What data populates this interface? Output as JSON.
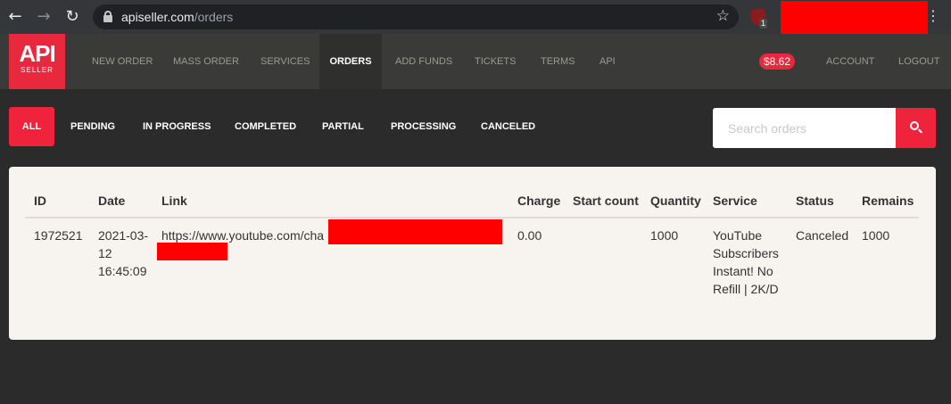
{
  "browser": {
    "back_icon": "arrow-left-icon",
    "forward_icon": "arrow-right-icon",
    "reload_icon": "reload-icon",
    "url_domain": "apiseller.com",
    "url_path": "/orders",
    "extension_badge": "1"
  },
  "site": {
    "logo_main": "API",
    "logo_sub": "SELLER",
    "nav": {
      "new_order": "NEW ORDER",
      "mass_order": "MASS ORDER",
      "services": "SERVICES",
      "orders": "ORDERS",
      "add_funds": "ADD FUNDS",
      "tickets": "TICKETS",
      "terms": "TERMS",
      "api": "API",
      "balance": "$8.62",
      "account": "ACCOUNT",
      "logout": "LOGOUT"
    }
  },
  "filters": {
    "all": "ALL",
    "pending": "PENDING",
    "in_progress": "IN PROGRESS",
    "completed": "COMPLETED",
    "partial": "PARTIAL",
    "processing": "PROCESSING",
    "canceled": "CANCELED"
  },
  "search": {
    "placeholder": "Search orders"
  },
  "table": {
    "headers": {
      "id": "ID",
      "date": "Date",
      "link": "Link",
      "charge": "Charge",
      "start_count": "Start count",
      "quantity": "Quantity",
      "service": "Service",
      "status": "Status",
      "remains": "Remains"
    },
    "rows": [
      {
        "id": "1972521",
        "date_line1": "2021-03-",
        "date_line2": "12",
        "date_line3": "16:45:09",
        "link": "https://www.youtube.com/cha",
        "charge": "0.00",
        "start_count": "",
        "quantity": "1000",
        "service_line1": "YouTube",
        "service_line2": "Subscribers",
        "service_line3": "Instant! No",
        "service_line4": "Refill | 2K/D",
        "status": "Canceled",
        "remains": "1000"
      }
    ]
  },
  "colors": {
    "accent": "#f0233c",
    "nav_bg": "#3a3a38",
    "page_bg": "#2b2b2b",
    "card_bg": "#f7f4ef",
    "redaction": "#ff0000"
  }
}
